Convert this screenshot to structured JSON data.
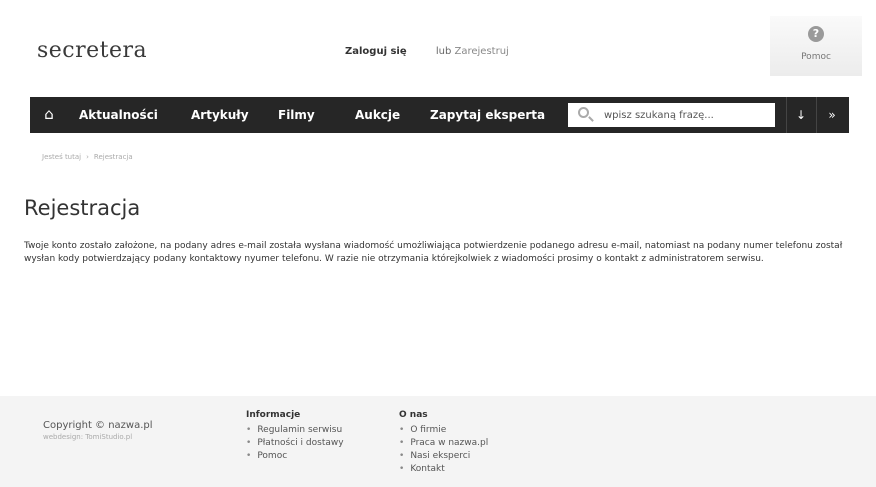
{
  "header": {
    "logo": "secretera",
    "login_label": "Zaloguj się",
    "or_label": "lub",
    "register_label": "Zarejestruj",
    "help_label": "Pomoc"
  },
  "nav": {
    "items": [
      "Aktualności",
      "Artykuły",
      "Filmy",
      "Aukcje",
      "Zapytaj eksperta"
    ],
    "search_placeholder": "wpisz szukaną frazę..."
  },
  "breadcrumb": {
    "current_location": "Jesteś tutaj",
    "page": "Rejestracja"
  },
  "main": {
    "title": "Rejestracja",
    "text": "Twoje konto zostało założone, na podany adres e-mail została wysłana wiadomość umożliwiająca potwierdzenie podanego adresu e-mail, natomiast na podany numer telefonu został wysłan kody potwierdzający podany kontaktowy nyumer telefonu. W razie nie otrzymania którejkolwiek z wiadomości prosimy o kontakt z administratorem serwisu."
  },
  "footer": {
    "copyright": "Copyright © nazwa.pl",
    "webdesign": "webdesign: TomiStudio.pl",
    "columns": [
      {
        "heading": "Informacje",
        "links": [
          "Regulamin serwisu",
          "Płatności i dostawy",
          "Pomoc"
        ]
      },
      {
        "heading": "O nas",
        "links": [
          "O firmie",
          "Praca w nazwa.pl",
          "Nasi eksperci",
          "Kontakt"
        ]
      }
    ]
  },
  "colors": {
    "navbar": "#262626",
    "footer": "#f4f4f4"
  },
  "icons": [
    "home-icon",
    "help-icon",
    "search-icon",
    "arrow-down-icon",
    "double-chevron-icon"
  ]
}
